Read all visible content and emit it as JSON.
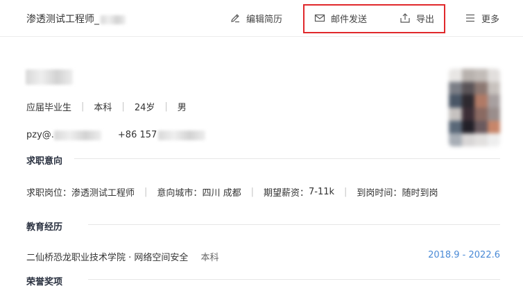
{
  "header": {
    "title": "渗透测试工程师_",
    "actions": {
      "edit": "编辑简历",
      "email": "邮件发送",
      "export": "导出",
      "more": "更多"
    }
  },
  "profile": {
    "status": "应届毕业生",
    "degree": "本科",
    "age": "24岁",
    "gender": "男",
    "email_prefix": "pzy@.",
    "phone_prefix": "+86 157"
  },
  "sections": {
    "intent": {
      "title": "求职意向",
      "position_label": "求职岗位：",
      "position": "渗透测试工程师",
      "city_label": "意向城市：",
      "city": "四川 成都",
      "salary_label": "期望薪资：",
      "salary": "7-11k",
      "arrival_label": "到岗时间：",
      "arrival": "随时到岗"
    },
    "education": {
      "title": "教育经历",
      "school_major": "二仙桥恐龙职业技术学院 · 网络空间安全",
      "degree": "本科",
      "period": "2018.9 - 2022.6"
    },
    "honors": {
      "title": "荣誉奖项"
    }
  },
  "colors": {
    "highlight": "#e0282b",
    "date": "#4a8ad6",
    "section_title": "#2a3140"
  }
}
